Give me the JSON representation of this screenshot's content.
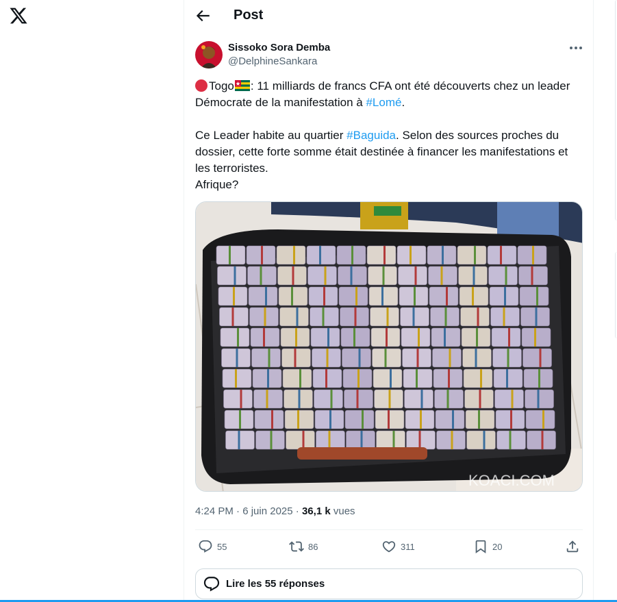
{
  "header": {
    "title": "Post"
  },
  "author": {
    "display_name": "Sissoko Sora Demba",
    "handle": "@DelphineSankara"
  },
  "tweet": {
    "line1_prefix": "Togo",
    "line1_rest": ": 11 milliards de francs CFA ont été découverts chez un leader Démocrate de la manifestation à ",
    "hashtag1": "#Lomé",
    "line1_end": ".",
    "para2_prefix": "Ce Leader habite au quartier ",
    "hashtag2": "#Baguida",
    "para2_rest": ". Selon des sources proches du dossier,  cette forte somme était destinée à financer les manifestations et les terroristes.",
    "line_last": "Afrique?"
  },
  "photo": {
    "watermark": "KOACI.COM"
  },
  "meta": {
    "time": "4:24 PM",
    "separator": "·",
    "date": "6 juin 2025",
    "views_count": "36,1 k",
    "views_label": " vues"
  },
  "actions": {
    "replies": "55",
    "reposts": "86",
    "likes": "311",
    "bookmarks": "20"
  },
  "replies_button": {
    "label": "Lire les 55 réponses"
  },
  "colors": {
    "accent": "#1d9bf0",
    "text": "#0f1419",
    "muted": "#536471"
  },
  "icons": [
    "x-logo-icon",
    "back-arrow-icon",
    "more-icon",
    "reply-icon",
    "repost-icon",
    "like-icon",
    "bookmark-icon",
    "share-icon",
    "speech-bubble-icon"
  ]
}
